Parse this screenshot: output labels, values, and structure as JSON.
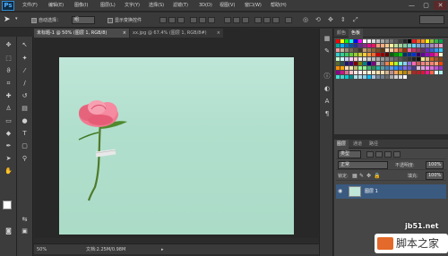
{
  "menu": {
    "logo": "Ps",
    "items": [
      "文件(F)",
      "编辑(E)",
      "图像(I)",
      "图层(L)",
      "文字(Y)",
      "选择(S)",
      "滤镜(T)",
      "3D(D)",
      "视图(V)",
      "窗口(W)",
      "帮助(H)"
    ],
    "window_buttons": {
      "minimize": "—",
      "restore": "▢",
      "close": "✕"
    }
  },
  "options": {
    "auto_select_label": "自动选择：",
    "auto_select_value": "组",
    "show_transform_label": "显示变换控件"
  },
  "tabs": {
    "active": "未标题-1 @ 50% (图层 1, RGB/8)",
    "active_close": "×",
    "inactive": "xx.jpg @ 67.4% (图层 1, RGB/8#)",
    "inactive_close": "×"
  },
  "status": {
    "zoom": "50%",
    "doc": "文档:2.25M/0.98M"
  },
  "swatches_panel": {
    "tabs": [
      "颜色",
      "色板"
    ],
    "colors": [
      "#ff0000",
      "#ffff00",
      "#00ff00",
      "#00ffff",
      "#0000ff",
      "#ff00ff",
      "#ffffff",
      "#f2f2f2",
      "#dadada",
      "#c0c0c0",
      "#a6a6a6",
      "#8c8c8c",
      "#737373",
      "#595959",
      "#404040",
      "#262626",
      "#000000",
      "#ed1c24",
      "#f26522",
      "#f7941d",
      "#fff200",
      "#8dc63f",
      "#39b54a",
      "#00a651",
      "#00a99d",
      "#00aeef",
      "#0072bc",
      "#0054a6",
      "#2e3192",
      "#662d91",
      "#92278f",
      "#ec008c",
      "#ed145b",
      "#f7977a",
      "#f9ad81",
      "#fdc68a",
      "#fff79a",
      "#c4df9b",
      "#a3d39c",
      "#82ca9d",
      "#7bcdc8",
      "#6ecff6",
      "#7ea7d8",
      "#8493ca",
      "#8882be",
      "#a187be",
      "#bc8dbf",
      "#f49ac2",
      "#f6989d",
      "#c6b39b",
      "#9d8b77",
      "#756959",
      "#5c4f41",
      "#40362a",
      "#c69c6d",
      "#a67c52",
      "#8c6239",
      "#754c24",
      "#603913",
      "#ffe0c0",
      "#ffcc99",
      "#ff9966",
      "#cc6633",
      "#993300",
      "#ff6699",
      "#cc3366",
      "#993366",
      "#663366",
      "#6633cc",
      "#3366cc",
      "#3399ff",
      "#33ccff",
      "#33cccc",
      "#33cc99",
      "#33cc66",
      "#66cc33",
      "#99cc33",
      "#cccc33",
      "#ffcc33",
      "#ff9933",
      "#ff6633",
      "#cc0000",
      "#990000",
      "#660000",
      "#006600",
      "#009900",
      "#00cc00",
      "#003366",
      "#003399",
      "#0033cc",
      "#330066",
      "#660099",
      "#9900cc",
      "#cc0099",
      "#ff3399",
      "#ffffcc",
      "#ccffcc",
      "#ccffff",
      "#ccccff",
      "#ffccff",
      "#ffcccc",
      "#eeeeee",
      "#dddddd",
      "#cccccc",
      "#bbbbbb",
      "#aaaaaa",
      "#999999",
      "#888888",
      "#777777",
      "#666666",
      "#555555",
      "#444444",
      "#333333",
      "#222222",
      "#111111",
      "#f0e68c",
      "#deb887",
      "#d2691e",
      "#a0522d",
      "#8b4513",
      "#556b2f",
      "#2f4f4f",
      "#191970",
      "#4b0082",
      "#800000",
      "#808000",
      "#008080",
      "#000080",
      "#800080",
      "#c0c0c0",
      "#808080",
      "#ff7f50",
      "#ffd700",
      "#adff2f",
      "#7fffd4",
      "#87cefa",
      "#9370db",
      "#ff69b4",
      "#cd5c5c",
      "#f08080",
      "#e9967a",
      "#fa8072",
      "#ffa07a",
      "#ff4500",
      "#ff8c00",
      "#ffa500",
      "#ffdab9",
      "#eee8aa",
      "#bdb76b",
      "#98fb98",
      "#90ee90",
      "#3cb371",
      "#2e8b57",
      "#20b2aa",
      "#5f9ea0",
      "#4682b4",
      "#6495ed",
      "#1e90ff",
      "#4169e1",
      "#7b68ee",
      "#6a5acd",
      "#483d8b",
      "#d8bfd8",
      "#dda0dd",
      "#ee82ee",
      "#da70d6",
      "#ba55d3",
      "#9932cc",
      "#8b008b",
      "#c71585",
      "#db7093",
      "#ffc0cb",
      "#ffe4e1",
      "#fff0f5",
      "#faebd7",
      "#f5f5dc",
      "#ffe4c4",
      "#ffdead",
      "#f5deb3",
      "#d2b48c",
      "#bc8f8f",
      "#f4a460",
      "#daa520",
      "#b8860b",
      "#cd853f",
      "#a52a2a",
      "#b22222",
      "#dc143c",
      "#ff1493",
      "#ff6347",
      "#e0ffff",
      "#afeeee",
      "#40e0d0",
      "#48d1cc",
      "#00ced1",
      "#008b8b",
      "#b0e0e6",
      "#add8e6",
      "#87ceeb",
      "#00bfff",
      "#b0c4de",
      "#778899",
      "#708090",
      "#696969",
      "#a9a9a9",
      "#d3d3d3",
      "#dcdcdc",
      "#f8f8ff"
    ]
  },
  "layers_panel": {
    "tabs": [
      "图层",
      "通道",
      "路径"
    ],
    "kind_label": "类型",
    "blend_mode": "正常",
    "opacity_label": "不透明度:",
    "opacity_value": "100%",
    "lock_label": "锁定:",
    "fill_label": "填充:",
    "fill_value": "100%",
    "layer_name": "图层 1"
  },
  "watermark": {
    "url": "jb51.net",
    "brand": "脚本之家"
  }
}
